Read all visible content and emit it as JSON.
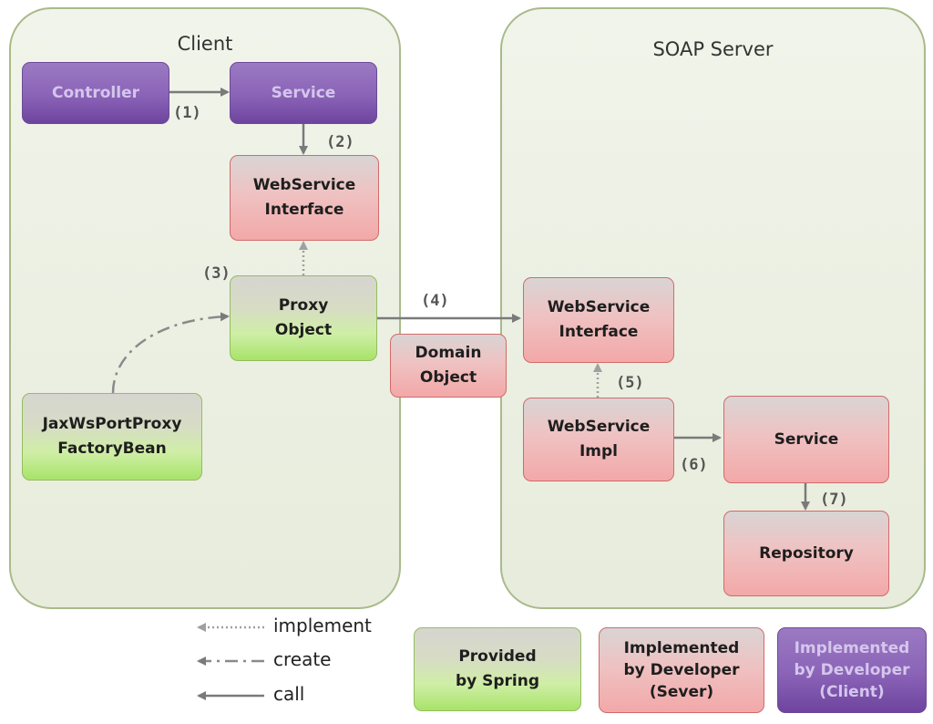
{
  "regions": {
    "client": "Client",
    "server": "SOAP Server"
  },
  "client_boxes": {
    "controller": "Controller",
    "service": "Service",
    "ws_interface": "WebService\nInterface",
    "proxy_object": "Proxy\nObject",
    "factory_bean": "JaxWsPortProxy\nFactoryBean"
  },
  "domain_object": "Domain\nObject",
  "server_boxes": {
    "ws_interface": "WebService\nInterface",
    "ws_impl": "WebService\nImpl",
    "service": "Service",
    "repository": "Repository"
  },
  "steps": [
    "(1)",
    "(2)",
    "(3)",
    "(4)",
    "(5)",
    "(6)",
    "(7)"
  ],
  "legend": {
    "implement": "implement",
    "create": "create",
    "call": "call",
    "spring": "Provided\nby Spring",
    "developer_server": "Implemented\nby Developer\n(Sever)",
    "developer_client": "Implemented\nby Developer\n(Client)"
  },
  "colors": {
    "spring_green": "#a8e36a",
    "server_red": "#f3a8a8",
    "client_purple": "#8a63b7",
    "arrow_gray": "#7a7a7a"
  }
}
